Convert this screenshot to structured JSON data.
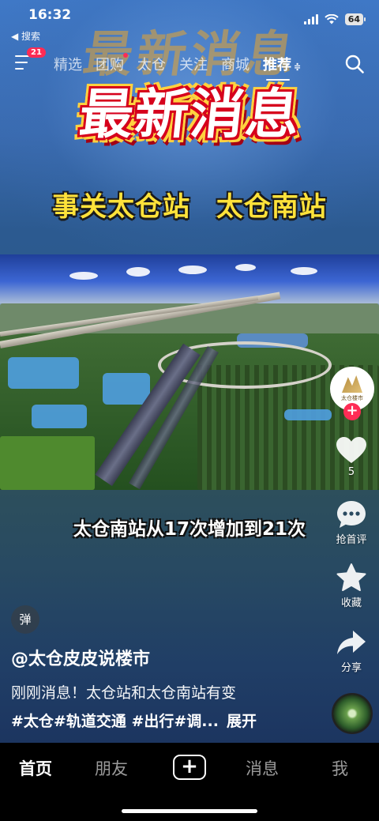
{
  "status_bar": {
    "time": "16:32",
    "back_app": "◀ 搜索",
    "battery": "64"
  },
  "top_nav": {
    "badge": "21",
    "tabs": [
      {
        "label": "精选",
        "active": false
      },
      {
        "label": "团购",
        "active": false,
        "dot": true
      },
      {
        "label": "太仓",
        "active": false
      },
      {
        "label": "关注",
        "active": false
      },
      {
        "label": "商城",
        "active": false
      },
      {
        "label": "推荐",
        "active": true
      }
    ],
    "more_symbol": "≑"
  },
  "video": {
    "ghost_title": "最新消息",
    "headline": "最新消息",
    "subhead": "事关太仓站 太仓南站",
    "caption": "太仓南站从17次增加到21次"
  },
  "rail": {
    "avatar_text": "太仓楼市",
    "follow": "+",
    "likes_count": "5",
    "comment_label": "抢首评",
    "favorite_label": "收藏",
    "share_label": "分享"
  },
  "info": {
    "danmu": "弹",
    "author": "@太仓皮皮说楼市",
    "description": "刚刚消息！太仓站和太仓南站有变",
    "tags": "#太仓#轨道交通 #出行#调...",
    "expand": "展开"
  },
  "tabbar": {
    "home": "首页",
    "friends": "朋友",
    "plus": "+",
    "messages": "消息",
    "me": "我"
  },
  "colors": {
    "accent": "#fe2c55",
    "headline_stroke": "#d6001c",
    "subhead": "#ffe23a"
  }
}
